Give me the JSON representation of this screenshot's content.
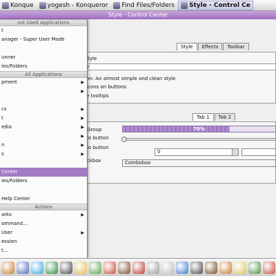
{
  "taskbar": {
    "tasks": [
      {
        "label": "Konque",
        "active": false
      },
      {
        "label": "yogesh - Konqueror",
        "active": false
      },
      {
        "label": "Find Files/Folders",
        "active": false
      },
      {
        "label": "Style - Control Ce",
        "active": true
      }
    ]
  },
  "window": {
    "title": "Style - Control Center"
  },
  "control_center": {
    "tabs": [
      "Style",
      "Effects",
      "Toolbar"
    ],
    "style_label": "tyle",
    "widget_style_value": "r",
    "description": "on: An almost simple and clean style",
    "opt_icons": "icons on buttons",
    "opt_tooltips": "e tooltips",
    "preview_tabs": [
      "Tab 1",
      "Tab 2"
    ],
    "group_label": "Group",
    "radio1": "io button",
    "radio2": "io button",
    "checkbox": "ckbox",
    "progress_text": "70%",
    "progress_value": 70,
    "spin_value": "0",
    "combo_value": "Combobox"
  },
  "kmenu": {
    "sec_most_used": "ost Used Applications",
    "most_used": [
      {
        "label": "t",
        "arrow": false
      },
      {
        "label": "anager - Super User Mode",
        "arrow": false
      },
      {
        "label": "",
        "arrow": false
      },
      {
        "label": "unner",
        "arrow": false
      },
      {
        "label": "les/Folders",
        "arrow": false
      }
    ],
    "sec_all": "All Applications",
    "all": [
      {
        "label": "pment",
        "arrow": true
      },
      {
        "label": "",
        "arrow": true
      },
      {
        "label": "",
        "arrow": false
      },
      {
        "label": "cs",
        "arrow": true
      },
      {
        "label": "t",
        "arrow": true
      },
      {
        "label": "edia",
        "arrow": true
      },
      {
        "label": "",
        "arrow": true
      },
      {
        "label": "n",
        "arrow": true
      },
      {
        "label": "s",
        "arrow": true
      },
      {
        "label": "",
        "arrow": false
      },
      {
        "label": "Center",
        "arrow": false,
        "highlight": true
      },
      {
        "label": "les/Folders",
        "arrow": false
      },
      {
        "label": "",
        "arrow": false
      },
      {
        "label": "Help Center",
        "arrow": false
      }
    ],
    "sec_actions": "Actions",
    "actions": [
      {
        "label": "arks",
        "arrow": true
      },
      {
        "label": "ommand...",
        "arrow": false
      },
      {
        "label": "User",
        "arrow": true
      },
      {
        "label": "ession",
        "arrow": false
      },
      {
        "label": "t...",
        "arrow": false
      }
    ]
  },
  "panel": {
    "icons": [
      "home-icon",
      "konqueror-icon",
      "browser-icon",
      "network-icon",
      "email-icon",
      "calendar-icon",
      "media-player-icon",
      "notes-icon",
      "spreadsheet-icon",
      "presentation-icon",
      "imageviewer-icon",
      "cd-icon",
      "music-icon",
      "headphones-icon",
      "chat-icon",
      "graphics-icon",
      "game-icon",
      "photo-icon",
      "settings-icon"
    ],
    "colors": [
      "#c97c2c",
      "#4a6fc0",
      "#3fa6e0",
      "#2d8f3c",
      "#444444",
      "#e6b94b",
      "#5ca348",
      "#cc4a3a",
      "#7b4a2c",
      "#b83a2b",
      "#999999",
      "#bbbbbb",
      "#3a78c8",
      "#444444",
      "#7a4a1f",
      "#c97c2c",
      "#e0c45a",
      "#4f8f3c",
      "#c94a3a"
    ]
  }
}
